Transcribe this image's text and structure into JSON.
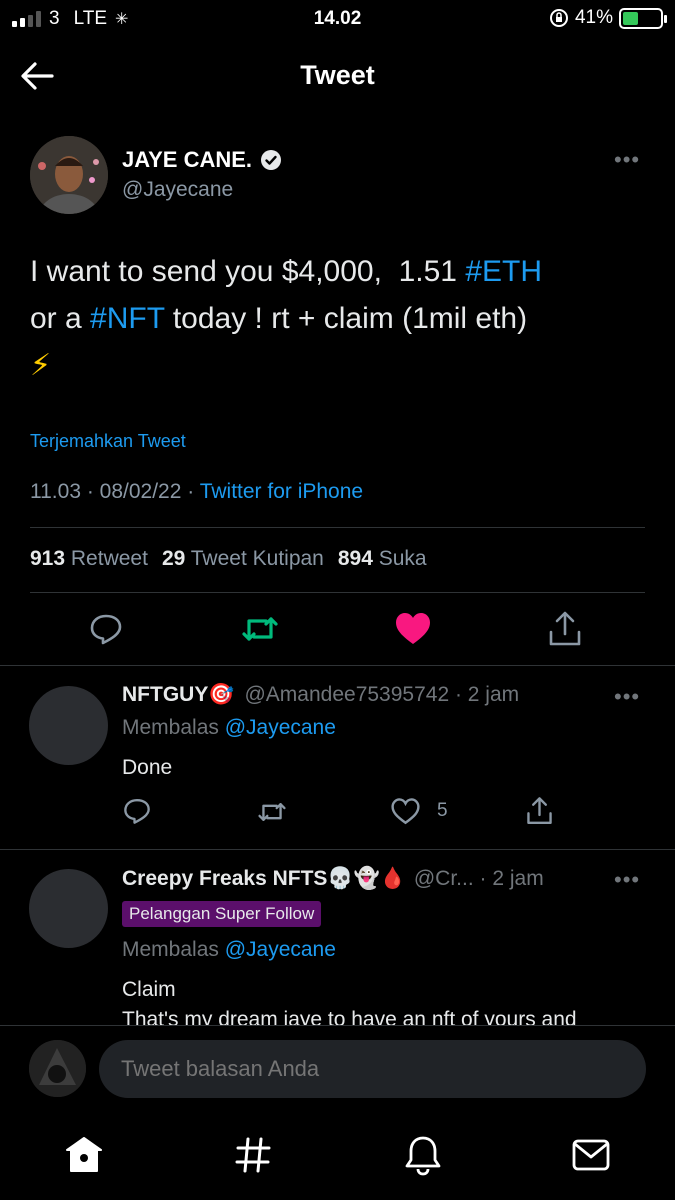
{
  "status": {
    "carrier": "3",
    "network": "LTE",
    "time": "14.02",
    "battery": "41%"
  },
  "header": {
    "title": "Tweet"
  },
  "tweet": {
    "author_name": "JAYE CANE.",
    "handle": "@Jayecane",
    "text_line1_plain": "I want to send you $4,000,  1.51 ",
    "tag_eth": "#ETH",
    "text_line2_pre": "or a ",
    "tag_nft": "#NFT",
    "text_line2_post": " today ! rt + claim (1mil eth)",
    "emoji": "⚡",
    "translate": "Terjemahkan Tweet",
    "timestamp": "11.03 · 08/02/22 · ",
    "source": "Twitter for iPhone",
    "stats": {
      "retweets_num": "913",
      "retweets_label": "Retweet",
      "quotes_num": "29",
      "quotes_label": "Tweet Kutipan",
      "likes_num": "894",
      "likes_label": "Suka"
    }
  },
  "replies": [
    {
      "name": "NFTGUY🎯",
      "meta": "@Amandee75395742 · 2 jam",
      "replying_prefix": "Membalas ",
      "replying_to": "@Jayecane",
      "text": "Done",
      "like_count": "5"
    },
    {
      "name": "Creepy Freaks NFTS💀👻🩸",
      "meta": "@Cr... · 2 jam",
      "badge": "Pelanggan Super Follow",
      "replying_prefix": "Membalas ",
      "replying_to": "@Jayecane",
      "text_line1": "Claim",
      "text_line2": "That's my dream jaye to have an nft of yours and"
    }
  ],
  "composer": {
    "placeholder": "Tweet balasan Anda"
  },
  "colors": {
    "accent": "#1d9bf0",
    "retweet": "#00ba7c",
    "like": "#f91880",
    "badge": "#5b0f6b"
  }
}
